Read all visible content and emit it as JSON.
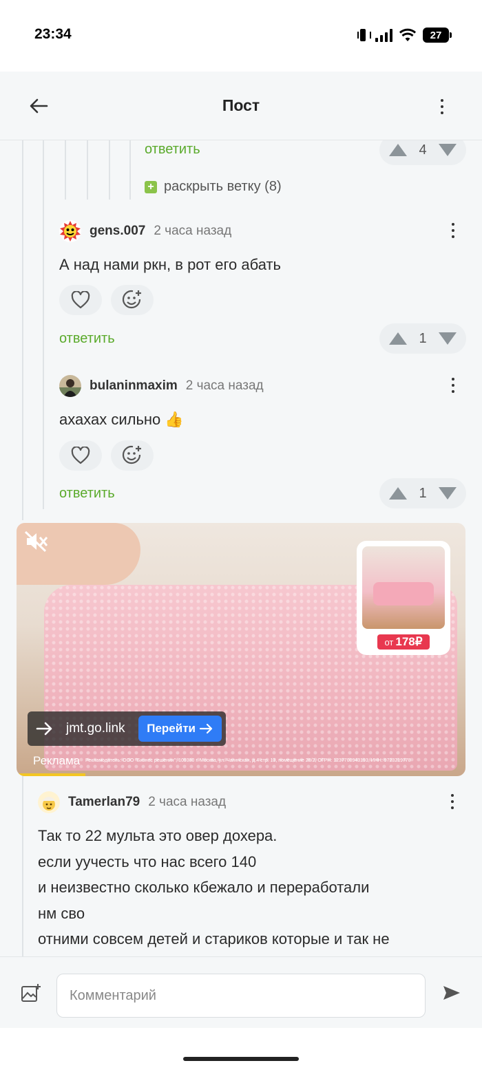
{
  "status_bar": {
    "time": "23:34",
    "battery": "27"
  },
  "header": {
    "title": "Пост"
  },
  "thread_top": {
    "reply_label": "ответить",
    "votes": "4",
    "expand_label": "раскрыть ветку (8)"
  },
  "comments": [
    {
      "username": "gens.007",
      "time": "2 часа назад",
      "text": "А над нами ркн, в рот его абать",
      "reply_label": "ответить",
      "votes": "1"
    },
    {
      "username": "bulaninmaxim",
      "time": "2 часа назад",
      "text": "ахахах сильно 👍",
      "reply_label": "ответить",
      "votes": "1"
    },
    {
      "username": "Tamerlan79",
      "time": "2 часа назад",
      "lines": [
        "Так то 22 мульта это овер дохера.",
        "если уучесть что нас всего 140",
        "и неизвестно сколько кбежало и переработали",
        "нм сво",
        "отними совсем детей и стариков которые и так не"
      ]
    }
  ],
  "ad": {
    "price_from": "от",
    "price": "178₽",
    "domain": "jmt.go.link",
    "button": "Перейти",
    "label": "Реклама",
    "disclaimer": "Рекламодатель: ООО \"Бизнес решения\", 109380 г. Москва, ул. Чагинская, д.4 стр. 13, помещение 28/2, ОГРН: 1237700943193, ИНН: 9723219778"
  },
  "comment_input": {
    "placeholder": "Комментарий"
  },
  "colors": {
    "accent_green": "#5aaa2b",
    "ad_button": "#2f7cf6",
    "price_tag": "#e8384f"
  }
}
